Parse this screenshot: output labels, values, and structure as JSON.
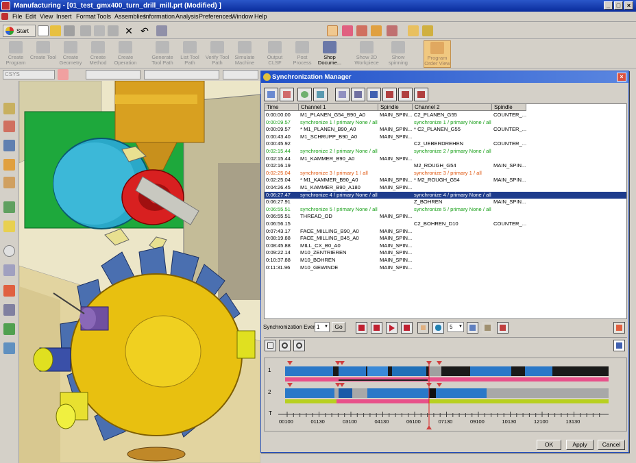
{
  "window": {
    "title": "Manufacturing - [01_test_gmx400_turn_drill_mill.prt (Modified) ]",
    "min_label": "_",
    "max_label": "□",
    "close_label": "×"
  },
  "menu": [
    "File",
    "Edit",
    "View",
    "Insert",
    "Format",
    "Tools",
    "Assemblies",
    "Information",
    "Analysis",
    "Preferences",
    "Window",
    "Help"
  ],
  "toolbar": {
    "start_label": "Start",
    "big_buttons": [
      {
        "label": "Create Program",
        "enabled": false
      },
      {
        "label": "Create Tool",
        "enabled": false
      },
      {
        "label": "Create Geometry",
        "enabled": false
      },
      {
        "label": "Create Method",
        "enabled": false
      },
      {
        "label": "Create Operation",
        "enabled": false
      },
      {
        "label": "Generate Tool Path",
        "enabled": false
      },
      {
        "label": "List Tool Path",
        "enabled": false
      },
      {
        "label": "Verify Tool Path",
        "enabled": false
      },
      {
        "label": "Simulate Machine",
        "enabled": false
      },
      {
        "label": "Output CLSF",
        "enabled": false
      },
      {
        "label": "Post Process",
        "enabled": false
      },
      {
        "label": "Shop Docume...",
        "enabled": true
      },
      {
        "label": "Show 2D Workpiece",
        "enabled": false
      },
      {
        "label": "Show spinning",
        "enabled": false
      },
      {
        "label": "Program Order View",
        "enabled": false
      }
    ],
    "csys_value": "CSYS"
  },
  "dialog": {
    "title": "Synchronization Manager",
    "close_label": "×",
    "columns": [
      "Time",
      "Channel 1",
      "Spindle",
      "Channel 2",
      "Spindle"
    ],
    "rows": [
      {
        "time": "0:00:00.00",
        "ch1": "M1_PLANEN_G54_B90_A0",
        "sp1": "MAIN_SPIN...",
        "ch2": "C2_PLANEN_G55",
        "sp2": "COUNTER_...",
        "style": ""
      },
      {
        "time": "0:00:09.57",
        "ch1": "synchronize 1 / primary None / all",
        "sp1": "",
        "ch2": "synchronize 1 / primary None / all",
        "sp2": "",
        "style": "green"
      },
      {
        "time": "0:00:09.57",
        "ch1": "* M1_PLANEN_B90_A0",
        "sp1": "MAIN_SPIN...",
        "ch2": "* C2_PLANEN_G55",
        "sp2": "COUNTER_...",
        "style": ""
      },
      {
        "time": "0:00:43.40",
        "ch1": "M1_SCHRUPP_B90_A0",
        "sp1": "MAIN_SPIN...",
        "ch2": "",
        "sp2": "",
        "style": ""
      },
      {
        "time": "0:00:45.92",
        "ch1": "",
        "sp1": "",
        "ch2": "C2_UEBERDREHEN",
        "sp2": "COUNTER_...",
        "style": ""
      },
      {
        "time": "0:02:15.44",
        "ch1": "synchronize 2 / primary None / all",
        "sp1": "",
        "ch2": "synchronize 2 / primary None / all",
        "sp2": "",
        "style": "green"
      },
      {
        "time": "0:02:15.44",
        "ch1": "M1_KAMMER_B90_A0",
        "sp1": "MAIN_SPIN...",
        "ch2": "",
        "sp2": "",
        "style": ""
      },
      {
        "time": "0:02:16.19",
        "ch1": "",
        "sp1": "",
        "ch2": "M2_ROUGH_G54",
        "sp2": "MAIN_SPIN...",
        "style": ""
      },
      {
        "time": "0:02:25.04",
        "ch1": "synchronize 3 / primary 1 / all",
        "sp1": "",
        "ch2": "synchronize 3 / primary 1 / all",
        "sp2": "",
        "style": "orange"
      },
      {
        "time": "0:02:25.04",
        "ch1": "* M1_KAMMER_B90_A0",
        "sp1": "MAIN_SPIN...",
        "ch2": "* M2_ROUGH_G54",
        "sp2": "MAIN_SPIN...",
        "style": ""
      },
      {
        "time": "0:04:26.45",
        "ch1": "M1_KAMMER_B90_A180",
        "sp1": "MAIN_SPIN...",
        "ch2": "",
        "sp2": "",
        "style": ""
      },
      {
        "time": "0:06:27.47",
        "ch1": "synchronize 4 / primary None / all",
        "sp1": "",
        "ch2": "synchronize 4 / primary None / all",
        "sp2": "",
        "style": "sel"
      },
      {
        "time": "0:06:27.91",
        "ch1": "",
        "sp1": "",
        "ch2": "Z_BOHREN",
        "sp2": "MAIN_SPIN...",
        "style": ""
      },
      {
        "time": "0:06:55.51",
        "ch1": "synchronize 5 / primary None / all",
        "sp1": "",
        "ch2": "synchronize 5 / primary None / all",
        "sp2": "",
        "style": "green"
      },
      {
        "time": "0:06:55.51",
        "ch1": "THREAD_OD",
        "sp1": "MAIN_SPIN...",
        "ch2": "",
        "sp2": "",
        "style": ""
      },
      {
        "time": "0:06:56.15",
        "ch1": "",
        "sp1": "",
        "ch2": "C2_BOHREN_D10",
        "sp2": "COUNTER_...",
        "style": ""
      },
      {
        "time": "0:07:43.17",
        "ch1": "FACE_MILLING_B90_A0",
        "sp1": "MAIN_SPIN...",
        "ch2": "",
        "sp2": "",
        "style": ""
      },
      {
        "time": "0:08:19.88",
        "ch1": "FACE_MILLING_B45_A0",
        "sp1": "MAIN_SPIN...",
        "ch2": "",
        "sp2": "",
        "style": ""
      },
      {
        "time": "0:08:45.88",
        "ch1": "MILL_CX_B0_A0",
        "sp1": "MAIN_SPIN...",
        "ch2": "",
        "sp2": "",
        "style": ""
      },
      {
        "time": "0:09:22.14",
        "ch1": "M10_ZENTRIEREN",
        "sp1": "MAIN_SPIN...",
        "ch2": "",
        "sp2": "",
        "style": ""
      },
      {
        "time": "0:10:37.88",
        "ch1": "M10_BOHREN",
        "sp1": "MAIN_SPIN...",
        "ch2": "",
        "sp2": "",
        "style": ""
      },
      {
        "time": "0:11:31.96",
        "ch1": "M10_GEWINDE",
        "sp1": "MAIN_SPIN...",
        "ch2": "",
        "sp2": "",
        "style": ""
      }
    ],
    "sync_event_label": "Synchronization Event",
    "sync_event_value": "1",
    "go_label": "Go",
    "speed_value": "5",
    "timeline": {
      "channel1_label": "1",
      "channel2_label": "2",
      "time_label": "T",
      "ticks": [
        "00100",
        "01130",
        "03100",
        "04130",
        "06100",
        "07130",
        "09100",
        "10130",
        "12100",
        "13130"
      ]
    },
    "ok_label": "OK",
    "apply_label": "Apply",
    "cancel_label": "Cancel"
  }
}
